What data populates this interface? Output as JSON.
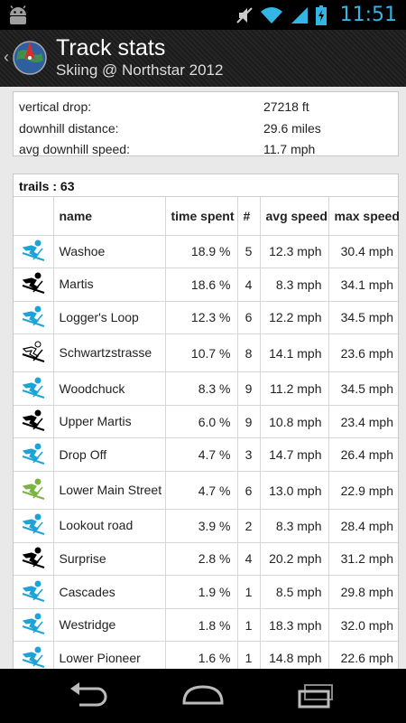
{
  "status_bar": {
    "time": "11:51"
  },
  "action_bar": {
    "title": "Track stats",
    "subtitle": "Skiing @ Northstar 2012"
  },
  "summary": [
    {
      "label": "vertical drop:",
      "value": "27218 ft"
    },
    {
      "label": "downhill distance:",
      "value": "29.6 miles"
    },
    {
      "label": "avg downhill speed:",
      "value": "11.7 mph"
    }
  ],
  "trails": {
    "header": "trails : 63",
    "columns": {
      "name": "name",
      "time_spent": "time spent",
      "count": "#",
      "avg_speed": "avg speed",
      "max_speed": "max speed"
    },
    "rows": [
      {
        "icon": "skier-blue-icon",
        "color": "#1da3d6",
        "name": "Washoe",
        "time": "18.9 %",
        "count": "5",
        "avg": "12.3 mph",
        "max": "30.4 mph"
      },
      {
        "icon": "skier-black-icon",
        "color": "#000000",
        "name": "Martis",
        "time": "18.6 %",
        "count": "4",
        "avg": "8.3 mph",
        "max": "34.1 mph"
      },
      {
        "icon": "skier-blue-icon",
        "color": "#1da3d6",
        "name": "Logger's Loop",
        "time": "12.3 %",
        "count": "6",
        "avg": "12.2 mph",
        "max": "34.5 mph"
      },
      {
        "icon": "skier-double-black-icon",
        "color": "#000000",
        "name": "Schwartzstrasse",
        "time": "10.7 %",
        "count": "8",
        "avg": "14.1 mph",
        "max": "23.6 mph"
      },
      {
        "icon": "skier-blue-icon",
        "color": "#1da3d6",
        "name": "Woodchuck",
        "time": "8.3 %",
        "count": "9",
        "avg": "11.2 mph",
        "max": "34.5 mph"
      },
      {
        "icon": "skier-black-icon",
        "color": "#000000",
        "name": "Upper Martis",
        "time": "6.0 %",
        "count": "9",
        "avg": "10.8 mph",
        "max": "23.4 mph"
      },
      {
        "icon": "skier-blue-icon",
        "color": "#1da3d6",
        "name": "Drop Off",
        "time": "4.7 %",
        "count": "3",
        "avg": "14.7 mph",
        "max": "26.4 mph"
      },
      {
        "icon": "skier-green-icon",
        "color": "#7cb342",
        "name": "Lower Main Street",
        "time": "4.7 %",
        "count": "6",
        "avg": "13.0 mph",
        "max": "22.9 mph"
      },
      {
        "icon": "skier-blue-icon",
        "color": "#1da3d6",
        "name": "Lookout road",
        "time": "3.9 %",
        "count": "2",
        "avg": "8.3 mph",
        "max": "28.4 mph"
      },
      {
        "icon": "skier-black-icon",
        "color": "#000000",
        "name": "Surprise",
        "time": "2.8 %",
        "count": "4",
        "avg": "20.2 mph",
        "max": "31.2 mph"
      },
      {
        "icon": "skier-blue-icon",
        "color": "#1da3d6",
        "name": "Cascades",
        "time": "1.9 %",
        "count": "1",
        "avg": "8.5 mph",
        "max": "29.8 mph"
      },
      {
        "icon": "skier-blue-icon",
        "color": "#1da3d6",
        "name": "Westridge",
        "time": "1.8 %",
        "count": "1",
        "avg": "18.3 mph",
        "max": "32.0 mph"
      },
      {
        "icon": "skier-blue-icon",
        "color": "#1da3d6",
        "name": "Lower Pioneer",
        "time": "1.6 %",
        "count": "1",
        "avg": "14.8 mph",
        "max": "22.6 mph"
      }
    ]
  },
  "colors": {
    "accent": "#33b5e5",
    "blue_trail": "#1da3d6",
    "green_trail": "#7cb342",
    "black_trail": "#000000"
  }
}
